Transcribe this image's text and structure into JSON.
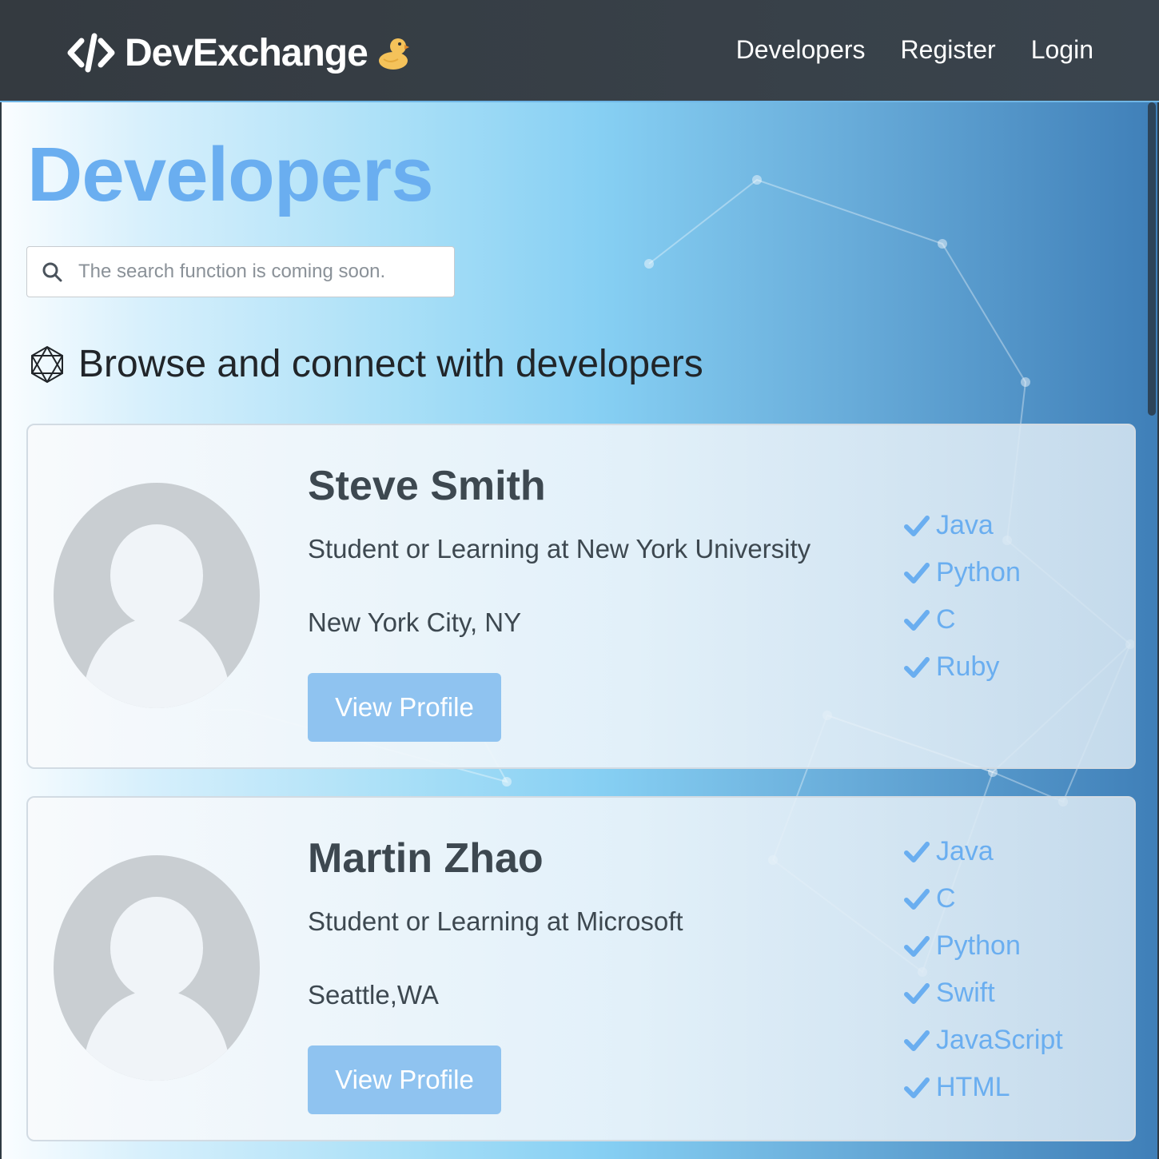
{
  "navbar": {
    "brand": "DevExchange",
    "links": [
      "Developers",
      "Register",
      "Login"
    ]
  },
  "main": {
    "title": "Developers",
    "search_placeholder": "The search function is coming soon.",
    "subtitle": "Browse and connect with developers"
  },
  "developers": [
    {
      "name": "Steve Smith",
      "status": "Student or Learning at New York University",
      "location": "New York City, NY",
      "button": "View Profile",
      "skills": [
        "Java",
        "Python",
        "C",
        "Ruby"
      ]
    },
    {
      "name": "Martin Zhao",
      "status": "Student or Learning at Microsoft",
      "location": "Seattle,WA",
      "button": "View Profile",
      "skills": [
        "Java",
        "C",
        "Python",
        "Swift",
        "JavaScript",
        "HTML"
      ]
    }
  ],
  "colors": {
    "navbar": "#343a40",
    "accent": "#6aaef0",
    "button": "#8fc3f0",
    "text": "#3d4850"
  },
  "icons": {
    "brand": "code-icon",
    "brand_decoration": "duck-icon",
    "search": "search-icon",
    "subtitle": "hexagon-network-icon",
    "skill": "check-icon",
    "avatar": "default-avatar-icon"
  }
}
